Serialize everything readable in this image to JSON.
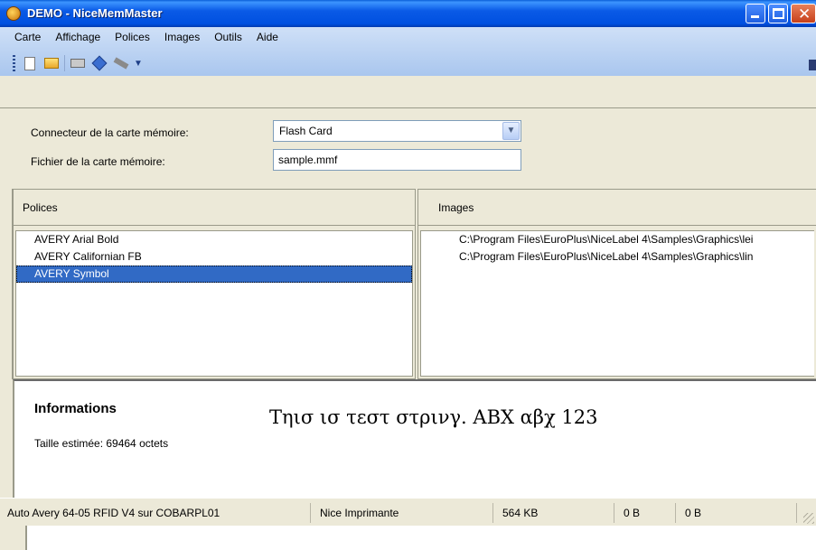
{
  "window": {
    "title": "DEMO - NiceMemMaster"
  },
  "menu": {
    "items": [
      {
        "label": "Carte"
      },
      {
        "label": "Affichage"
      },
      {
        "label": "Polices"
      },
      {
        "label": "Images"
      },
      {
        "label": "Outils"
      },
      {
        "label": "Aide"
      }
    ]
  },
  "toolbar": {
    "icons": [
      "new-file-icon",
      "open-folder-icon",
      "print-icon",
      "send-icon",
      "erase-icon",
      "info-icon",
      "toolbar-options-icon"
    ]
  },
  "settings": {
    "connector_label": "Connecteur de la carte mémoire:",
    "connector_value": "Flash Card",
    "file_label": "Fichier de la carte mémoire:",
    "file_value": "sample.mmf"
  },
  "fonts_panel": {
    "header": "Polices",
    "items": [
      "AVERY Arial Bold",
      "AVERY Californian FB",
      "AVERY Symbol"
    ],
    "selected_index": 2
  },
  "images_panel": {
    "header": "Images",
    "items": [
      "C:\\Program Files\\EuroPlus\\NiceLabel 4\\Samples\\Graphics\\lei",
      "C:\\Program Files\\EuroPlus\\NiceLabel 4\\Samples\\Graphics\\lin"
    ]
  },
  "info": {
    "title": "Informations",
    "size_text": "Taille estimée: 69464 octets",
    "sample_text": "Τηισ ισ τεστ στρινγ. ΑΒΧ αβχ 123"
  },
  "statusbar": {
    "printer": "Auto Avery 64-05 RFID V4 sur COBARPL01",
    "driver": "Nice Imprimante",
    "memory": "564 KB",
    "used1": "0 B",
    "used2": "0 B"
  },
  "colors": {
    "titlebar": "#0a5ae6",
    "selection": "#316ac5",
    "window_bg": "#ece9d8"
  }
}
